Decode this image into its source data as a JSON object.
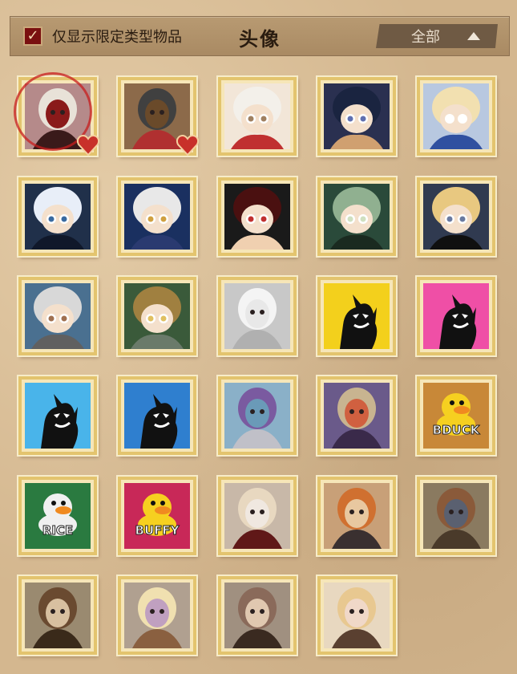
{
  "header": {
    "filter_label": "仅显示限定类型物品",
    "filter_checked": true,
    "title": "头像",
    "dropdown_value": "全部"
  },
  "avatars": [
    {
      "name": "avatar-portrait-white-hair",
      "selected": true,
      "favorite": true,
      "bg": "#b58a8a",
      "style": "portrait",
      "colors": [
        "#e8e2d8",
        "#3a1a1a",
        "#8a1a1a"
      ]
    },
    {
      "name": "avatar-masked-knight",
      "favorite": true,
      "bg": "#8c6a4a",
      "style": "portrait",
      "colors": [
        "#404040",
        "#b03030",
        "#6a4a2a"
      ]
    },
    {
      "name": "avatar-chibi-red-flower",
      "bg": "#f2e6d8",
      "style": "chibi",
      "colors": [
        "#f3f0ea",
        "#c03030",
        "#a08060"
      ]
    },
    {
      "name": "avatar-chibi-blue-hat",
      "bg": "#2a3050",
      "style": "chibi",
      "colors": [
        "#1a2440",
        "#d0a070",
        "#6070b0"
      ]
    },
    {
      "name": "avatar-chibi-blonde-blue",
      "bg": "#b8c8e0",
      "style": "chibi",
      "colors": [
        "#f2e0b0",
        "#3050a0",
        "#ffffff"
      ]
    },
    {
      "name": "avatar-chibi-masks-dark",
      "bg": "#20304a",
      "style": "chibi",
      "colors": [
        "#e8eef8",
        "#10182a",
        "#3a6aa0"
      ]
    },
    {
      "name": "avatar-chibi-white-hair-hat",
      "bg": "#1a3060",
      "style": "chibi",
      "colors": [
        "#e8e8e8",
        "#2a3a70",
        "#d0a040"
      ]
    },
    {
      "name": "avatar-chibi-red-hair",
      "bg": "#1a1a1a",
      "style": "chibi",
      "colors": [
        "#4a1010",
        "#f0d0b0",
        "#c03030"
      ]
    },
    {
      "name": "avatar-chibi-green-ghost",
      "bg": "#2a4a3a",
      "style": "chibi",
      "colors": [
        "#90b090",
        "#1a2a20",
        "#d0e0c0"
      ]
    },
    {
      "name": "avatar-chibi-blonde-blindfold",
      "bg": "#303a50",
      "style": "chibi",
      "colors": [
        "#e8c880",
        "#101010",
        "#6a7aa0"
      ]
    },
    {
      "name": "avatar-chibi-grey-curls",
      "bg": "#4a7090",
      "style": "chibi",
      "colors": [
        "#d8d8d8",
        "#606060",
        "#a07050"
      ]
    },
    {
      "name": "avatar-chibi-goggles-machine",
      "bg": "#3a5a3a",
      "style": "chibi",
      "colors": [
        "#a08040",
        "#6a7a6a",
        "#e0c060"
      ]
    },
    {
      "name": "avatar-white-doll",
      "bg": "#c8c8c8",
      "style": "portrait",
      "colors": [
        "#f4f4f4",
        "#b0b0b0",
        "#e8e8e8"
      ]
    },
    {
      "name": "avatar-persona-yellow",
      "bg": "#f3d01c",
      "style": "silhouette",
      "colors": [
        "#111111",
        "#ffffff"
      ]
    },
    {
      "name": "avatar-persona-pink",
      "bg": "#ef4fa6",
      "style": "silhouette",
      "colors": [
        "#111111",
        "#ffffff"
      ]
    },
    {
      "name": "avatar-persona-blue-fox",
      "bg": "#49b4ea",
      "style": "silhouette",
      "colors": [
        "#111111",
        "#ffffff"
      ]
    },
    {
      "name": "avatar-persona-blue-cat",
      "bg": "#2f7fcf",
      "style": "silhouette",
      "colors": [
        "#111111",
        "#ffffff"
      ]
    },
    {
      "name": "avatar-purple-hair-mask",
      "bg": "#8ab0c8",
      "style": "portrait",
      "colors": [
        "#7a5aa0",
        "#c0c0c8",
        "#6a9ab8"
      ]
    },
    {
      "name": "avatar-paper-bag",
      "bg": "#6a5a8a",
      "style": "portrait",
      "colors": [
        "#c8b490",
        "#3a2a4a",
        "#d06040"
      ]
    },
    {
      "name": "avatar-duck-bduck",
      "bg": "#c88838",
      "style": "badge",
      "text": "BDUCK",
      "colors": [
        "#f6d020",
        "#ffffff"
      ]
    },
    {
      "name": "avatar-duck-rice",
      "bg": "#2a7a40",
      "style": "badge",
      "text": "RICE",
      "colors": [
        "#f0f0f0",
        "#f0e050"
      ]
    },
    {
      "name": "avatar-duck-buffy",
      "bg": "#c82858",
      "style": "badge",
      "text": "BUFFY",
      "colors": [
        "#f6d020",
        "#ffffff"
      ]
    },
    {
      "name": "avatar-pale-girl",
      "bg": "#c8b8a8",
      "style": "portrait",
      "colors": [
        "#e8d8c0",
        "#601818",
        "#f0e8e0"
      ]
    },
    {
      "name": "avatar-orange-hair-hat",
      "bg": "#c8a078",
      "style": "portrait",
      "colors": [
        "#d07030",
        "#3a3030",
        "#e8c8a0"
      ]
    },
    {
      "name": "avatar-diver-helmet",
      "bg": "#8a7a60",
      "style": "portrait",
      "colors": [
        "#8a5a3a",
        "#4a3a2a",
        "#5a6070"
      ]
    },
    {
      "name": "avatar-brown-hood-goggles",
      "bg": "#9a8a70",
      "style": "portrait",
      "colors": [
        "#6a4a30",
        "#3a2a1a",
        "#d8c0a0"
      ]
    },
    {
      "name": "avatar-blonde-goggles",
      "bg": "#b0a090",
      "style": "portrait",
      "colors": [
        "#f0e0b0",
        "#8a6040",
        "#c0a0c0"
      ]
    },
    {
      "name": "avatar-catgirl-goggles",
      "bg": "#a09080",
      "style": "portrait",
      "colors": [
        "#8a6a5a",
        "#3a2a20",
        "#e0c8b0"
      ]
    },
    {
      "name": "avatar-girl-goggles-blonde",
      "bg": "#e8d8c0",
      "style": "portrait",
      "colors": [
        "#e8c890",
        "#5a4030",
        "#f0d8c8"
      ]
    }
  ]
}
